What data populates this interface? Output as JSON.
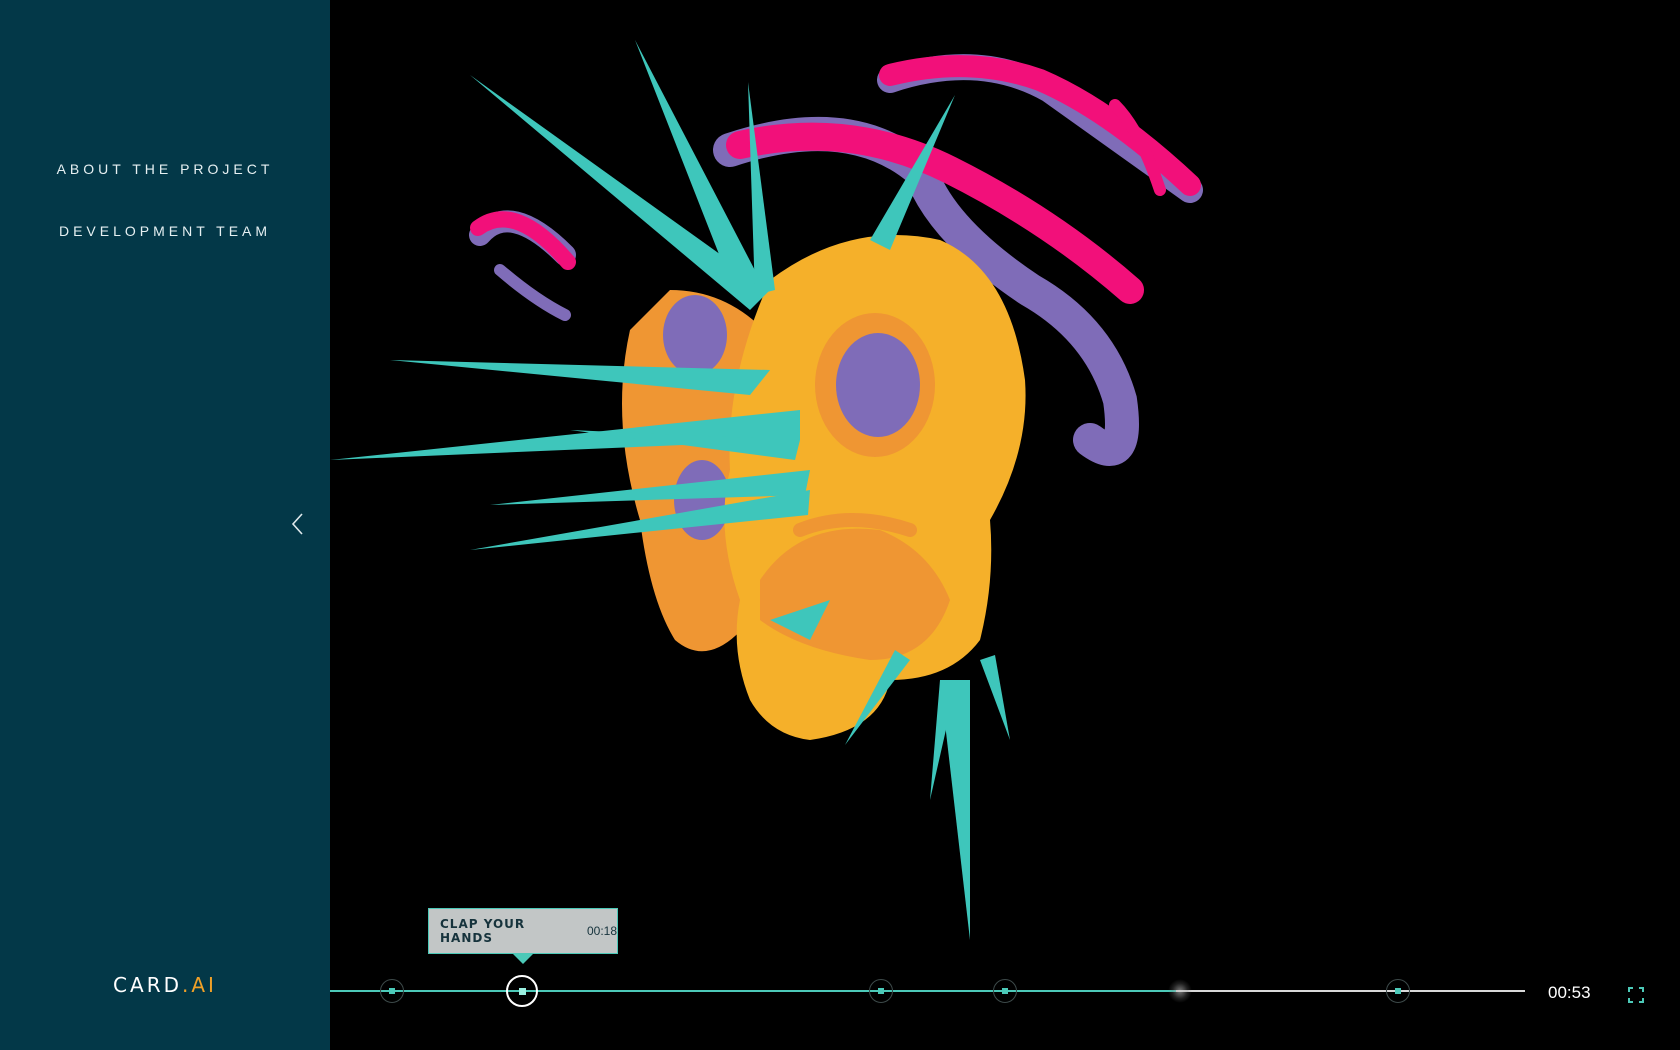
{
  "nav": {
    "about": "ABOUT THE PROJECT",
    "team": "DEVELOPMENT TEAM"
  },
  "logo": {
    "part1": "CARD",
    "part2": ".AI"
  },
  "colors": {
    "sidebar": "#033848",
    "accent": "#4cc9b8",
    "logo_accent": "#f0a028",
    "skull": "#f5b02a",
    "skull_shade": "#ef9633",
    "spikes": "#3ec6bb",
    "ribbon_pink": "#f2107a",
    "ribbon_purple": "#7f6cb8"
  },
  "player": {
    "tooltip": {
      "title": "CLAP YOUR HANDS",
      "time": "00:18"
    },
    "current_time": "00:53",
    "progress_fraction": 0.708
  },
  "icons": {
    "collapse": "chevron-left-icon",
    "fullscreen": "fullscreen-icon"
  }
}
